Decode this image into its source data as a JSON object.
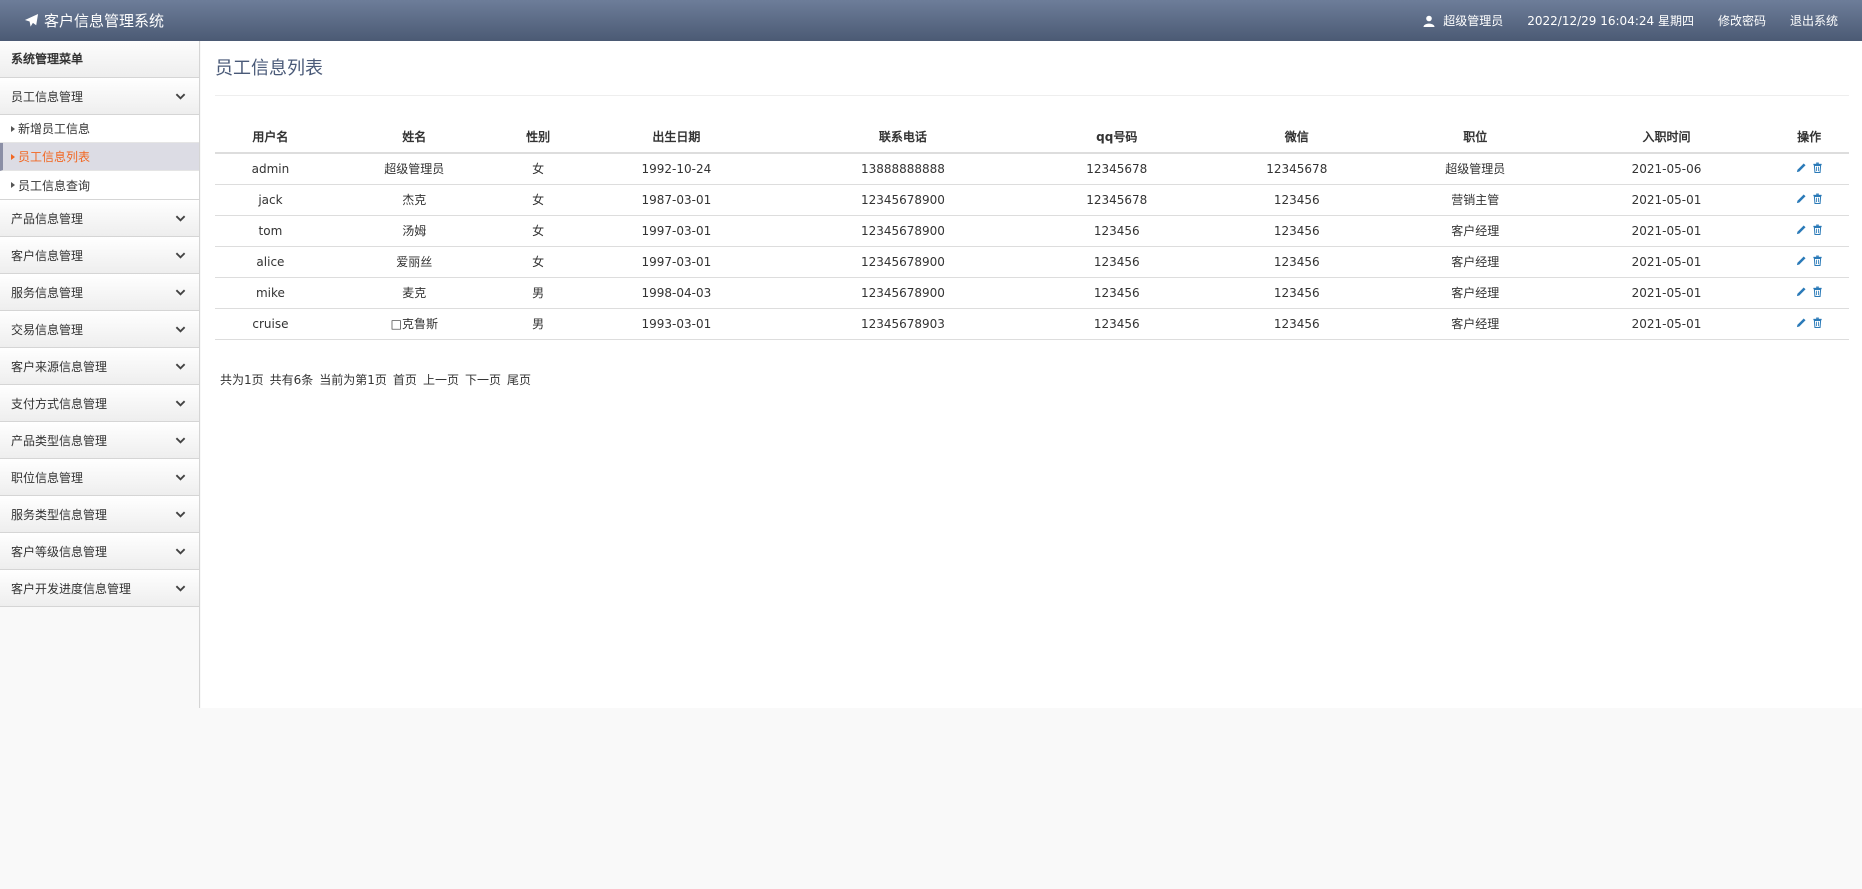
{
  "app": {
    "title": "客户信息管理系统",
    "icon": "paper-plane-icon"
  },
  "header": {
    "user": "超级管理员",
    "datetime": "2022/12/29 16:04:24 星期四",
    "change_password": "修改密码",
    "logout": "退出系统"
  },
  "sidebar": {
    "title": "系统管理菜单",
    "expanded_section": {
      "label": "员工信息管理",
      "items": [
        {
          "label": "新增员工信息",
          "active": false
        },
        {
          "label": "员工信息列表",
          "active": true
        },
        {
          "label": "员工信息查询",
          "active": false
        }
      ]
    },
    "sections": [
      "产品信息管理",
      "客户信息管理",
      "服务信息管理",
      "交易信息管理",
      "客户来源信息管理",
      "支付方式信息管理",
      "产品类型信息管理",
      "职位信息管理",
      "服务类型信息管理",
      "客户等级信息管理",
      "客户开发进度信息管理"
    ]
  },
  "main": {
    "title": "员工信息列表",
    "table": {
      "columns": [
        "用户名",
        "姓名",
        "性别",
        "出生日期",
        "联系电话",
        "qq号码",
        "微信",
        "职位",
        "入职时间",
        "操作"
      ],
      "rows": [
        [
          "admin",
          "超级管理员",
          "女",
          "1992-10-24",
          "13888888888",
          "12345678",
          "12345678",
          "超级管理员",
          "2021-05-06"
        ],
        [
          "jack",
          "杰克",
          "女",
          "1987-03-01",
          "12345678900",
          "12345678",
          "123456",
          "营销主管",
          "2021-05-01"
        ],
        [
          "tom",
          "汤姆",
          "女",
          "1997-03-01",
          "12345678900",
          "123456",
          "123456",
          "客户经理",
          "2021-05-01"
        ],
        [
          "alice",
          "爱丽丝",
          "女",
          "1997-03-01",
          "12345678900",
          "123456",
          "123456",
          "客户经理",
          "2021-05-01"
        ],
        [
          "mike",
          "麦克",
          "男",
          "1998-04-03",
          "12345678900",
          "123456",
          "123456",
          "客户经理",
          "2021-05-01"
        ],
        [
          "cruise",
          "□克鲁斯",
          "男",
          "1993-03-01",
          "12345678903",
          "123456",
          "123456",
          "客户经理",
          "2021-05-01"
        ]
      ]
    },
    "pagination": {
      "total_pages": "共为1页",
      "total_records": "共有6条",
      "current": "当前为第1页",
      "first": "首页",
      "prev": "上一页",
      "next": "下一页",
      "last": "尾页"
    }
  },
  "colors": {
    "header_top": "#6d7d99",
    "header_bottom": "#4b5a74",
    "active_item": "#f26722",
    "action_icon": "#2a7ab8",
    "title": "#4a5a78"
  }
}
